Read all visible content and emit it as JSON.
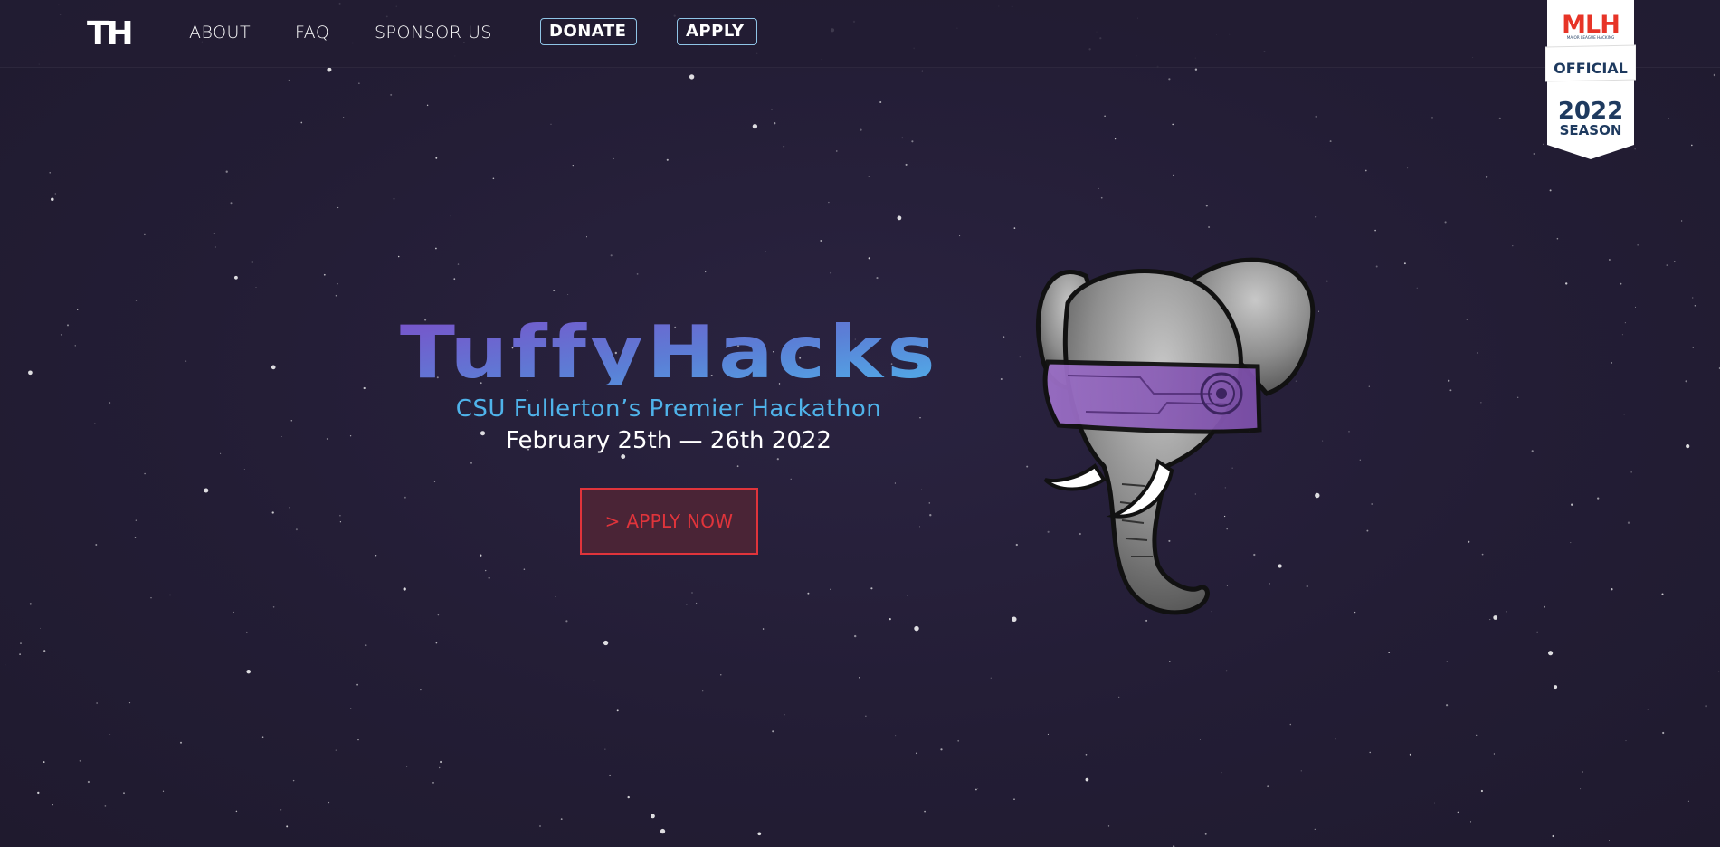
{
  "nav": {
    "logo_text": "TH",
    "links": [
      "ABOUT",
      "FAQ",
      "SPONSOR US"
    ],
    "donate_label": "DONATE",
    "apply_label": "APPLY"
  },
  "mlh_badge": {
    "logo_text": "MLH",
    "tagline": "MAJOR LEAGUE HACKING",
    "official": "OFFICIAL",
    "year": "2022",
    "season": "SEASON"
  },
  "hero": {
    "title": "TuffyHacks",
    "subtitle": "CSU Fullerton’s Premier Hackathon",
    "date": "February 25th — 26th 2022",
    "cta_label": "> APPLY NOW"
  },
  "colors": {
    "background": "#221c33",
    "accent_blue": "#4fb3ea",
    "accent_purple": "#7b4fc9",
    "cta_red": "#e0343b",
    "nav_button_border": "#8fc4e6"
  },
  "icons": {
    "mascot": "elephant-mascot-vr-headset",
    "badge": "mlh-official-badge"
  }
}
